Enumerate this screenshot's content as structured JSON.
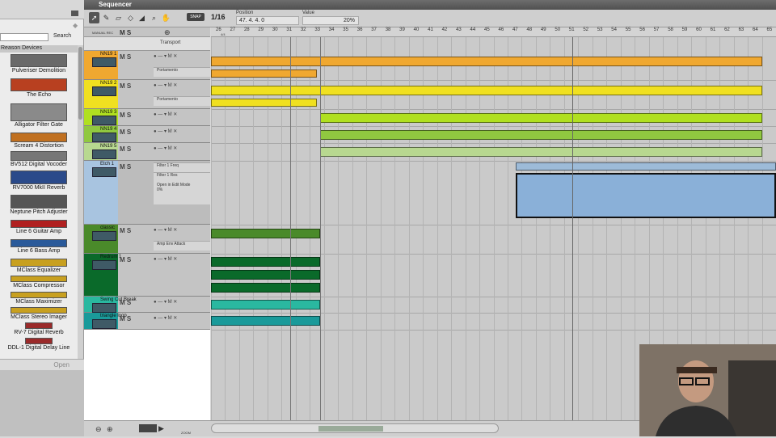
{
  "browser": {
    "search_label": "Search",
    "section_title": "Reason Devices",
    "open_label": "Open",
    "devices": [
      "Pulveriser Demolition",
      "The Echo",
      "Alligator Filter Gate",
      "Scream 4 Distortion",
      "BV512 Digital Vocoder",
      "RV7000 MkII Reverb",
      "Neptune Pitch Adjuster",
      "Line 6 Guitar Amp",
      "Line 6 Bass Amp",
      "MClass Equalizer",
      "MClass Compressor",
      "MClass Maximizer",
      "MClass Stereo Imager",
      "RV-7 Digital Reverb",
      "DDL-1 Digital Delay Line"
    ]
  },
  "sequencer": {
    "title": "Sequencer",
    "snap_label": "SNAP",
    "quantize": "1/16",
    "position_label": "Position",
    "position_value": "47.  4.  4.    0",
    "value_label": "Value",
    "value_value": "20%",
    "manual_rec": "MANUAL REC",
    "transport_label": "Transport",
    "zoom_label": "ZOOM",
    "ruler": [
      "26",
      "27",
      "28",
      "29",
      "30",
      "31",
      "32",
      "33",
      "34",
      "35",
      "36",
      "37",
      "38",
      "39",
      "40",
      "41",
      "42",
      "43",
      "44",
      "45",
      "46",
      "47",
      "48",
      "49",
      "50",
      "51",
      "52",
      "53",
      "54",
      "55",
      "56",
      "57",
      "58",
      "59",
      "60",
      "61",
      "62",
      "63",
      "64",
      "65"
    ],
    "ruler_sig": "4/4"
  },
  "lanes": [
    {
      "name": "NN19 1",
      "color": "#f0a830",
      "sub": "Portamento"
    },
    {
      "name": "NN19 2",
      "color": "#f0e020",
      "sub": "Portamento"
    },
    {
      "name": "NN19 3",
      "color": "#b0e020"
    },
    {
      "name": "NN19 4",
      "color": "#90c840"
    },
    {
      "name": "NN19 5",
      "color": "#b8d890"
    },
    {
      "name": "Etch 1",
      "color": "#a8c4e0",
      "sub": "Filter 1 Freq",
      "sub2": "Filter 1 Res",
      "edit": "Open in Edit Mode",
      "pct": "0%"
    },
    {
      "name": "classic",
      "color": "#4a8a2a",
      "sub": "Amp Env Attack"
    },
    {
      "name": "Redrum 1",
      "color": "#0a6a2a"
    },
    {
      "name": "Swing Cut Break",
      "color": "#2ab8a0"
    },
    {
      "name": "triangle loop",
      "color": "#1a9a9a"
    }
  ],
  "colors": {
    "accent": "#f0a830",
    "selection": "#8ab0d8"
  }
}
